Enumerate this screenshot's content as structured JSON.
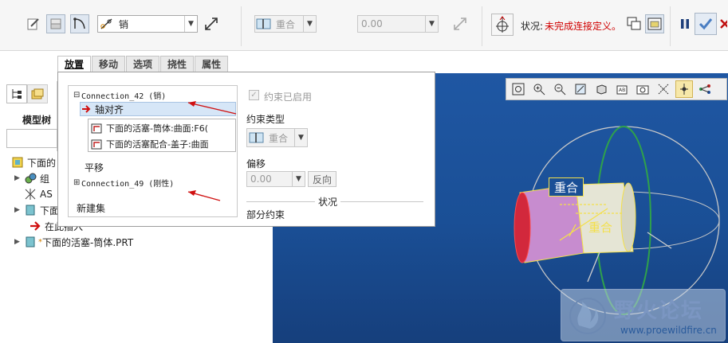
{
  "dashboard": {
    "constraint_type": "销",
    "constraint_set": "重合",
    "offset_value": "0.00",
    "status_label": "状况:",
    "status_text": "未完成连接定义。",
    "status_color": "#d00000"
  },
  "tabs": [
    {
      "label": "放置",
      "active": true
    },
    {
      "label": "移动",
      "active": false
    },
    {
      "label": "选项",
      "active": false
    },
    {
      "label": "挠性",
      "active": false
    },
    {
      "label": "属性",
      "active": false
    }
  ],
  "left_panel": {
    "title": "模型树"
  },
  "tree": {
    "items": [
      {
        "label": "下面的",
        "icon": "assembly-icon"
      },
      {
        "label": "组",
        "icon": "group-icon"
      },
      {
        "label": "AS",
        "icon": "csys-icon"
      },
      {
        "label": "下面",
        "icon": "part-icon"
      },
      {
        "label": "在此插入",
        "icon": "insert-arrow-icon"
      },
      {
        "label": "下面的活塞-筒体.PRT",
        "icon": "part-icon"
      }
    ]
  },
  "panel": {
    "connection_1": "Connection_42 (销)",
    "constraint_active": "轴对齐",
    "ref_1": "下面的活塞-筒体:曲面:F6(",
    "ref_2": "下面的活塞配合-盖子:曲面",
    "translate": "平移",
    "connection_2": "Connection_49 (刚性)",
    "new_set": "新建集",
    "constraint_enabled": "约束已启用",
    "constraint_type_label": "约束类型",
    "constraint_type_value": "重合",
    "offset_label": "偏移",
    "offset_value": "0.00",
    "flip_label": "反向",
    "status_section": "状况",
    "partial_constraint": "部分约束"
  },
  "viewport": {
    "tag_1": "重合",
    "tag_2": "重合",
    "background": "#1c519a"
  },
  "watermark": {
    "title": "野火论坛",
    "url": "www.proewildfire.cn"
  }
}
